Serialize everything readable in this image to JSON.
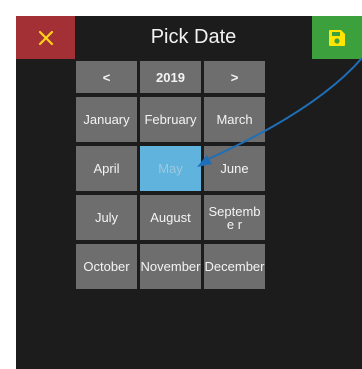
{
  "header": {
    "title": "Pick Date",
    "cancel_icon": "close-icon",
    "save_icon": "floppy-disk-icon",
    "colors": {
      "cancel": "#a33034",
      "save": "#3ca13c",
      "save_icon": "#ffe500",
      "cancel_icon": "#ffd21a"
    }
  },
  "nav": {
    "prev_label": "<",
    "year": "2019",
    "next_label": ">"
  },
  "months": [
    "January",
    "February",
    "March",
    "April",
    "May",
    "June",
    "July",
    "August",
    "Septembe r",
    "October",
    "November",
    "December"
  ],
  "selected_month": "May",
  "colors": {
    "background": "#1c1c1c",
    "cell": "#6e6e6e",
    "selected": "#5fb3dc",
    "annotation_arrow": "#1f6fb8"
  }
}
